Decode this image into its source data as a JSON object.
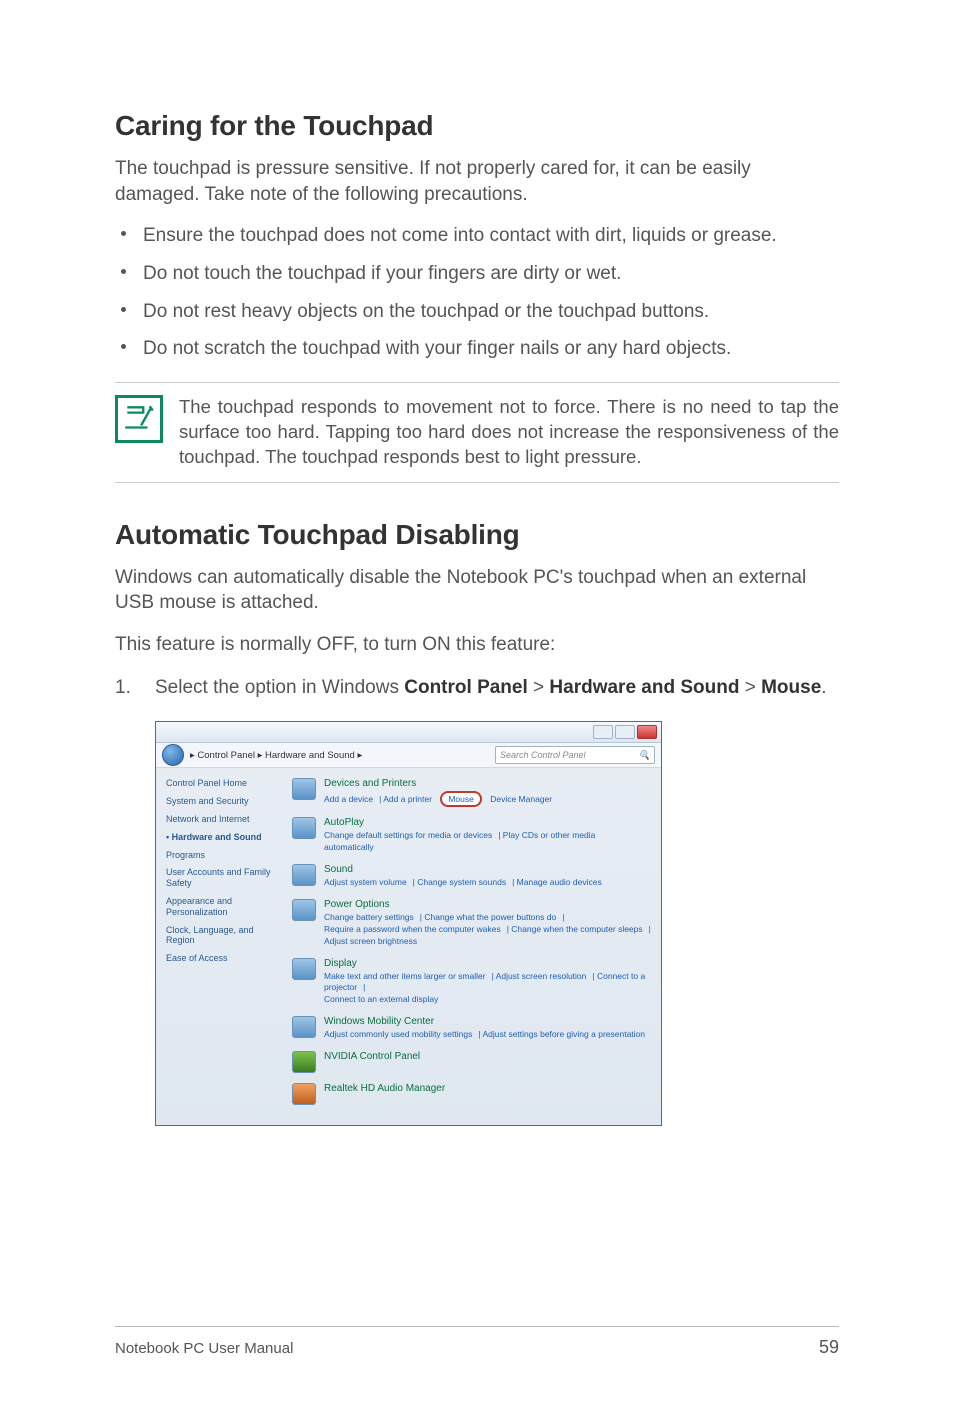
{
  "doc": {
    "h1": "Caring for the Touchpad",
    "p1": "The touchpad is pressure sensitive. If not properly cared for, it can be easily damaged. Take note of the following precautions.",
    "precautions": [
      "Ensure the touchpad does not come into contact with dirt, liquids or grease.",
      "Do not touch the touchpad if your fingers are dirty or wet.",
      "Do not rest heavy objects on the touchpad or the touchpad buttons.",
      "Do not scratch the touchpad with your finger nails or any hard objects."
    ],
    "note": "The touchpad responds to movement not to force. There is no need to tap the surface too hard. Tapping too hard does not increase the responsiveness of the touchpad. The touchpad responds best to light pressure.",
    "h2": "Automatic Touchpad Disabling",
    "p2": "Windows can automatically disable the Notebook PC's touchpad when an external USB mouse is attached.",
    "p3": "This feature is normally OFF, to turn ON this feature:",
    "step1_pre": "Select the option in Windows ",
    "step1_b1": "Control Panel",
    "step1_gt1": " > ",
    "step1_b2": "Hardware and Sound",
    "step1_gt2": " > ",
    "step1_b3": "Mouse",
    "step1_dot": "."
  },
  "ss": {
    "crumb": "  ▸  Control Panel  ▸  Hardware and Sound  ▸",
    "search_placeholder": "Search Control Panel",
    "side": {
      "home": "Control Panel Home",
      "items": [
        "System and Security",
        "Network and Internet",
        "Hardware and Sound",
        "Programs",
        "User Accounts and Family Safety",
        "Appearance and Personalization",
        "Clock, Language, and Region",
        "Ease of Access"
      ],
      "selected_index": 2
    },
    "cats": {
      "devices": {
        "title": "Devices and Printers",
        "l1": "Add a device",
        "l2": "Add a printer",
        "l3": "Mouse",
        "l4": "Device Manager"
      },
      "autoplay": {
        "title": "AutoPlay",
        "l1": "Change default settings for media or devices",
        "l2": "Play CDs or other media automatically"
      },
      "sound": {
        "title": "Sound",
        "l1": "Adjust system volume",
        "l2": "Change system sounds",
        "l3": "Manage audio devices"
      },
      "power": {
        "title": "Power Options",
        "l1": "Change battery settings",
        "l2": "Change what the power buttons do",
        "l3": "Require a password when the computer wakes",
        "l4": "Change when the computer sleeps",
        "l5": "Adjust screen brightness"
      },
      "display": {
        "title": "Display",
        "l1": "Make text and other items larger or smaller",
        "l2": "Adjust screen resolution",
        "l3": "Connect to a projector",
        "l4": "Connect to an external display"
      },
      "mobility": {
        "title": "Windows Mobility Center",
        "l1": "Adjust commonly used mobility settings",
        "l2": "Adjust settings before giving a presentation"
      },
      "nvidia": {
        "title": "NVIDIA Control Panel"
      },
      "realtek": {
        "title": "Realtek HD Audio Manager"
      }
    }
  },
  "footer": {
    "manual": "Notebook PC User Manual",
    "page": "59"
  }
}
